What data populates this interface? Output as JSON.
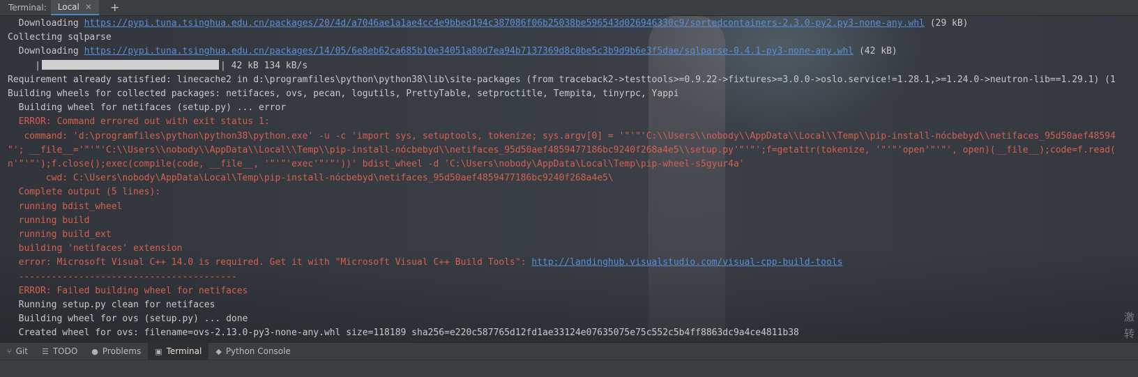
{
  "tabbar": {
    "title": "Terminal:",
    "tab_label": "Local",
    "close_glyph": "✕",
    "add_glyph": "+"
  },
  "terminal": {
    "lines": [
      {
        "kind": "text",
        "pre": "  Downloading ",
        "link": "https://pypi.tuna.tsinghua.edu.cn/packages/20/4d/a7046ae1a1ae4cc4e9bbed194c387086f06b25038be596543d026946330c9/sortedcontainers-2.3.0-py2.py3-none-any.whl",
        "post": " (29 kB)"
      },
      {
        "kind": "text",
        "pre": "Collecting sqlparse"
      },
      {
        "kind": "text",
        "pre": "  Downloading ",
        "link": "https://pypi.tuna.tsinghua.edu.cn/packages/14/05/6e8eb62ca685b10e34051a80d7ea94b7137369d8c0be5c3b9d9b6e3f5dae/sqlparse-0.4.1-py3-none-any.whl",
        "post": " (42 kB)"
      },
      {
        "kind": "progress",
        "pre": "     |",
        "post": "| 42 kB 134 kB/s",
        "fraction": 1.0
      },
      {
        "kind": "text",
        "pre": "Requirement already satisfied: linecache2 in d:\\programfiles\\python\\python38\\lib\\site-packages (from traceback2->testtools>=0.9.22->fixtures>=3.0.0->oslo.service!=1.28.1,>=1.24.0->neutron-lib==1.29.1) (1"
      },
      {
        "kind": "text",
        "pre": "Building wheels for collected packages: netifaces, ovs, pecan, logutils, PrettyTable, setproctitle, Tempita, tinyrpc, Yappi"
      },
      {
        "kind": "text",
        "pre": "  Building wheel for netifaces (setup.py) ... error"
      },
      {
        "kind": "err",
        "pre": "  ERROR: Command errored out with exit status 1:"
      },
      {
        "kind": "err",
        "pre": "   command: 'd:\\programfiles\\python\\python38\\python.exe' -u -c 'import sys, setuptools, tokenize; sys.argv[0] = '\"'\"'C:\\\\Users\\\\nobody\\\\AppData\\\\Local\\\\Temp\\\\pip-install-nócbebyd\\\\netifaces_95d50aef48594"
      },
      {
        "kind": "err",
        "pre": "\"'; __file__='\"'\"'C:\\\\Users\\\\nobody\\\\AppData\\\\Local\\\\Temp\\\\pip-install-nócbebyd\\\\netifaces_95d50aef4859477186bc9240f268a4e5\\\\setup.py'\"'\"';f=getattr(tokenize, '\"'\"'open'\"'\"', open)(__file__);code=f.read("
      },
      {
        "kind": "err",
        "pre": "n'\"'\"');f.close();exec(compile(code, __file__, '\"'\"'exec'\"'\"'))' bdist_wheel -d 'C:\\Users\\nobody\\AppData\\Local\\Temp\\pip-wheel-s5gyur4a'"
      },
      {
        "kind": "err",
        "pre": "       cwd: C:\\Users\\nobody\\AppData\\Local\\Temp\\pip-install-nócbebyd\\netifaces_95d50aef4859477186bc9240f268a4e5\\"
      },
      {
        "kind": "err",
        "pre": "  Complete output (5 lines):"
      },
      {
        "kind": "err",
        "pre": "  running bdist_wheel"
      },
      {
        "kind": "err",
        "pre": "  running build"
      },
      {
        "kind": "err",
        "pre": "  running build_ext"
      },
      {
        "kind": "err",
        "pre": "  building 'netifaces' extension"
      },
      {
        "kind": "err",
        "pre": "  error: Microsoft Visual C++ 14.0 is required. Get it with \"Microsoft Visual C++ Build Tools\": ",
        "link": "http://landinghub.visualstudio.com/visual-cpp-build-tools"
      },
      {
        "kind": "err",
        "pre": "  ----------------------------------------"
      },
      {
        "kind": "err",
        "pre": "  ERROR: Failed building wheel for netifaces"
      },
      {
        "kind": "text",
        "pre": "  Running setup.py clean for netifaces"
      },
      {
        "kind": "text",
        "pre": "  Building wheel for ovs (setup.py) ... done"
      },
      {
        "kind": "text",
        "pre": "  Created wheel for ovs: filename=ovs-2.13.0-py3-none-any.whl size=118189 sha256=e220c587765d12fd1ae33124e07635075e75c552c5b4ff8863dc9a4ce4811b38"
      }
    ],
    "side_glyphs": [
      "激",
      "转"
    ]
  },
  "toolbar": {
    "items": [
      {
        "id": "git",
        "icon": "branch-icon",
        "glyph": "⑂",
        "label": "Git",
        "active": false
      },
      {
        "id": "todo",
        "icon": "list-icon",
        "glyph": "☰",
        "label": "TODO",
        "active": false
      },
      {
        "id": "problems",
        "icon": "info-icon",
        "glyph": "●",
        "label": "Problems",
        "active": false
      },
      {
        "id": "terminal",
        "icon": "terminal-icon",
        "glyph": "▣",
        "label": "Terminal",
        "active": true
      },
      {
        "id": "python-console",
        "icon": "python-icon",
        "glyph": "◆",
        "label": "Python Console",
        "active": false
      }
    ]
  }
}
